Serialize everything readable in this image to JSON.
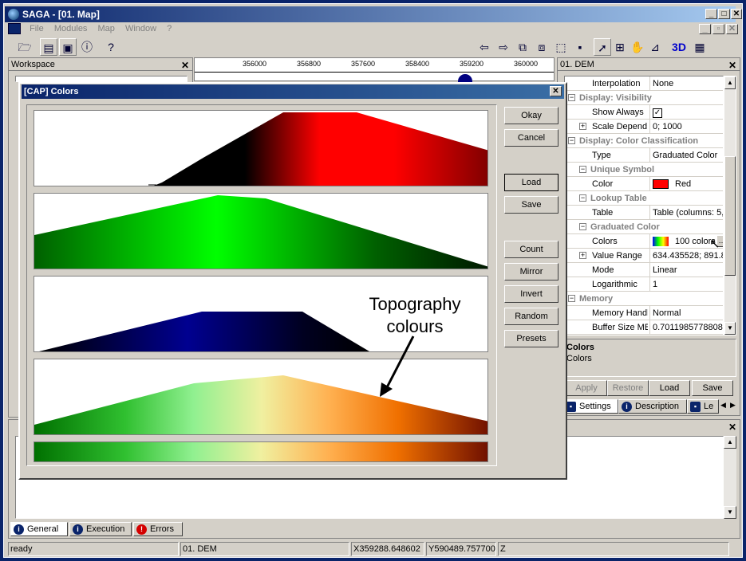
{
  "app": {
    "title": "SAGA - [01. Map]"
  },
  "menu": [
    "File",
    "Modules",
    "Map",
    "Window",
    "?"
  ],
  "workspace": {
    "title": "Workspace"
  },
  "map": {
    "ruler_ticks": [
      "356000",
      "356800",
      "357600",
      "358400",
      "359200",
      "360000"
    ]
  },
  "properties": {
    "title": "01. DEM",
    "rows": [
      {
        "kind": "prop",
        "name": "Interpolation",
        "value": "None"
      },
      {
        "kind": "group",
        "label": "Display: Visibility"
      },
      {
        "kind": "prop",
        "name": "Show Always",
        "value": "✓"
      },
      {
        "kind": "prop",
        "name": "Scale Depend",
        "value": "0; 1000"
      },
      {
        "kind": "group",
        "label": "Display: Color Classification"
      },
      {
        "kind": "prop",
        "name": "Type",
        "value": "Graduated Color"
      },
      {
        "kind": "subgroup",
        "label": "Unique Symbol"
      },
      {
        "kind": "prop",
        "name": "Color",
        "value": "Red"
      },
      {
        "kind": "subgroup",
        "label": "Lookup Table"
      },
      {
        "kind": "prop",
        "name": "Table",
        "value": "Table (columns: 5, r"
      },
      {
        "kind": "subgroup",
        "label": "Graduated Color"
      },
      {
        "kind": "prop",
        "name": "Colors",
        "value": "100 colors"
      },
      {
        "kind": "prop",
        "name": "Value Range",
        "value": "634.435528; 891.8"
      },
      {
        "kind": "prop",
        "name": "Mode",
        "value": "Linear"
      },
      {
        "kind": "prop",
        "name": "Logarithmic",
        "value": "1"
      },
      {
        "kind": "group",
        "label": "Memory"
      },
      {
        "kind": "prop",
        "name": "Memory Handling",
        "value": "Normal"
      },
      {
        "kind": "prop",
        "name": "Buffer Size MB",
        "value": "0.70119857788085"
      }
    ],
    "desc_title": "Colors",
    "desc_text": "Colors",
    "buttons": {
      "apply": "Apply",
      "restore": "Restore",
      "load": "Load",
      "save": "Save"
    },
    "tabs": {
      "settings": "Settings",
      "description": "Description",
      "legend": "Le"
    }
  },
  "dialog": {
    "title": "[CAP] Colors",
    "buttons": {
      "okay": "Okay",
      "cancel": "Cancel",
      "load": "Load",
      "save": "Save",
      "count": "Count",
      "mirror": "Mirror",
      "invert": "Invert",
      "random": "Random",
      "presets": "Presets"
    }
  },
  "messages": {
    "tabs": {
      "general": "General",
      "execution": "Execution",
      "errors": "Errors"
    }
  },
  "annotation": {
    "line1": "Topography",
    "line2": "colours"
  },
  "status": {
    "state": "ready",
    "layer": "01. DEM",
    "x": "X359288.648602",
    "y": "Y590489.757700",
    "z": "Z"
  },
  "colors": {
    "title_bar": "#0a246a",
    "face": "#d4d0c8",
    "red_swatch": "#ff0000"
  }
}
